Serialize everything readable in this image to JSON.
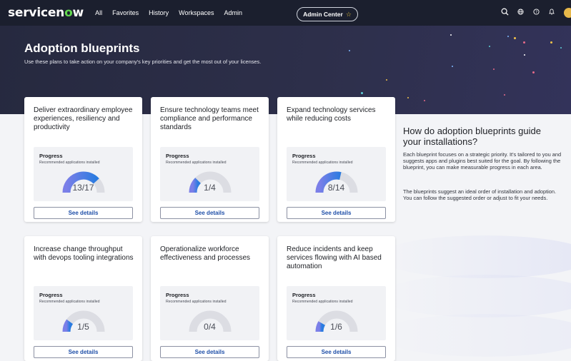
{
  "nav": {
    "logo_pre": "servicen",
    "logo_o": "o",
    "logo_post": "w",
    "items": [
      "All",
      "Favorites",
      "History",
      "Workspaces",
      "Admin"
    ],
    "center_pill": "Admin Center",
    "star": "☆"
  },
  "hero": {
    "title": "Adoption blueprints",
    "subtitle": "Use these plans to take action on your company's key priorities and get the most out of your licenses."
  },
  "cards": [
    {
      "title": "Deliver extraordinary employee experiences, resiliency and productivity",
      "progress_label": "Progress",
      "progress_sub": "Recommended applications installed",
      "installed": 13,
      "total": 17,
      "progress_text": "13/17",
      "button": "See details"
    },
    {
      "title": "Ensure technology teams meet compliance and performance standards",
      "progress_label": "Progress",
      "progress_sub": "Recommended applications installed",
      "installed": 1,
      "total": 4,
      "progress_text": "1/4",
      "button": "See details"
    },
    {
      "title": "Expand technology services while reducing costs",
      "progress_label": "Progress",
      "progress_sub": "Recommended applications installed",
      "installed": 8,
      "total": 14,
      "progress_text": "8/14",
      "button": "See details"
    },
    {
      "title": "Increase change throughput with devops tooling integrations",
      "progress_label": "Progress",
      "progress_sub": "Recommended applications installed",
      "installed": 1,
      "total": 5,
      "progress_text": "1/5",
      "button": "See details"
    },
    {
      "title": "Operationalize workforce effectiveness and processes",
      "progress_label": "Progress",
      "progress_sub": "Recommended applications installed",
      "installed": 0,
      "total": 4,
      "progress_text": "0/4",
      "button": "See details"
    },
    {
      "title": "Reduce incidents and keep services flowing with AI based automation",
      "progress_label": "Progress",
      "progress_sub": "Recommended applications installed",
      "installed": 1,
      "total": 6,
      "progress_text": "1/6",
      "button": "See details"
    }
  ],
  "side": {
    "title": "How do adoption blueprints guide your installations?",
    "p1": "Each blueprint focuses on a strategic priority. It's tailored to you and suggests apps and plugins best suited for the goal. By following the blueprint, you can make measurable progress in each area.",
    "p2": "The blueprints suggest an ideal order of installation and adoption. You can follow the suggested order or adjust to fit your needs."
  },
  "colors": {
    "gauge_track": "#dcdde3",
    "gauge_start": "#7b7fe8",
    "gauge_end": "#2a7be0",
    "link": "#1f4fa8",
    "logo_green": "#62d84e"
  }
}
